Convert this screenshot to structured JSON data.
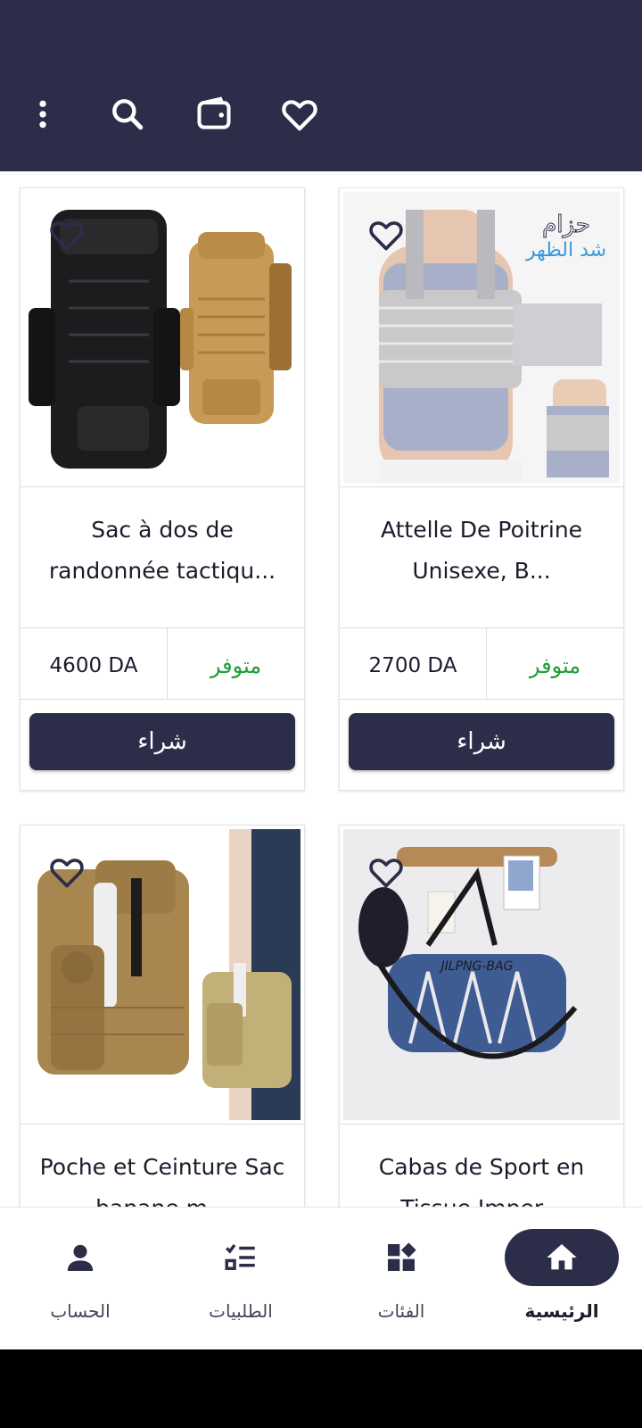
{
  "header": {
    "icons": [
      "more-vert-icon",
      "search-icon",
      "wallet-icon",
      "heart-icon"
    ]
  },
  "products": [
    {
      "title": "Attelle De Poitrine Unisexe, B...",
      "price": "2700 DA",
      "status": "متوفر",
      "buy_label": "شراء",
      "image": "chest-brace-photo"
    },
    {
      "title": "Sac à dos de randonnée tactiqu...",
      "price": "4600 DA",
      "status": "متوفر",
      "buy_label": "شراء",
      "image": "backpacks-photo"
    },
    {
      "title": "Cabas de Sport en Tissue Imper...",
      "price": "",
      "status": "",
      "buy_label": "",
      "image": "sport-bag-photo"
    },
    {
      "title": "Poche et Ceinture Sac banane m...",
      "price": "",
      "status": "",
      "buy_label": "",
      "image": "belt-pouch-photo"
    }
  ],
  "chest_brace_logo": "حزام شد الظهر",
  "nav": {
    "items": [
      {
        "label": "الرئيسية",
        "icon": "home-icon",
        "active": true
      },
      {
        "label": "الفئات",
        "icon": "categories-icon",
        "active": false
      },
      {
        "label": "الطلبيات",
        "icon": "orders-list-icon",
        "active": false
      },
      {
        "label": "الحساب",
        "icon": "account-icon",
        "active": false
      }
    ]
  },
  "colors": {
    "primary": "#2c2d49",
    "available_green": "#1f9d3a",
    "background": "#ffffff"
  }
}
